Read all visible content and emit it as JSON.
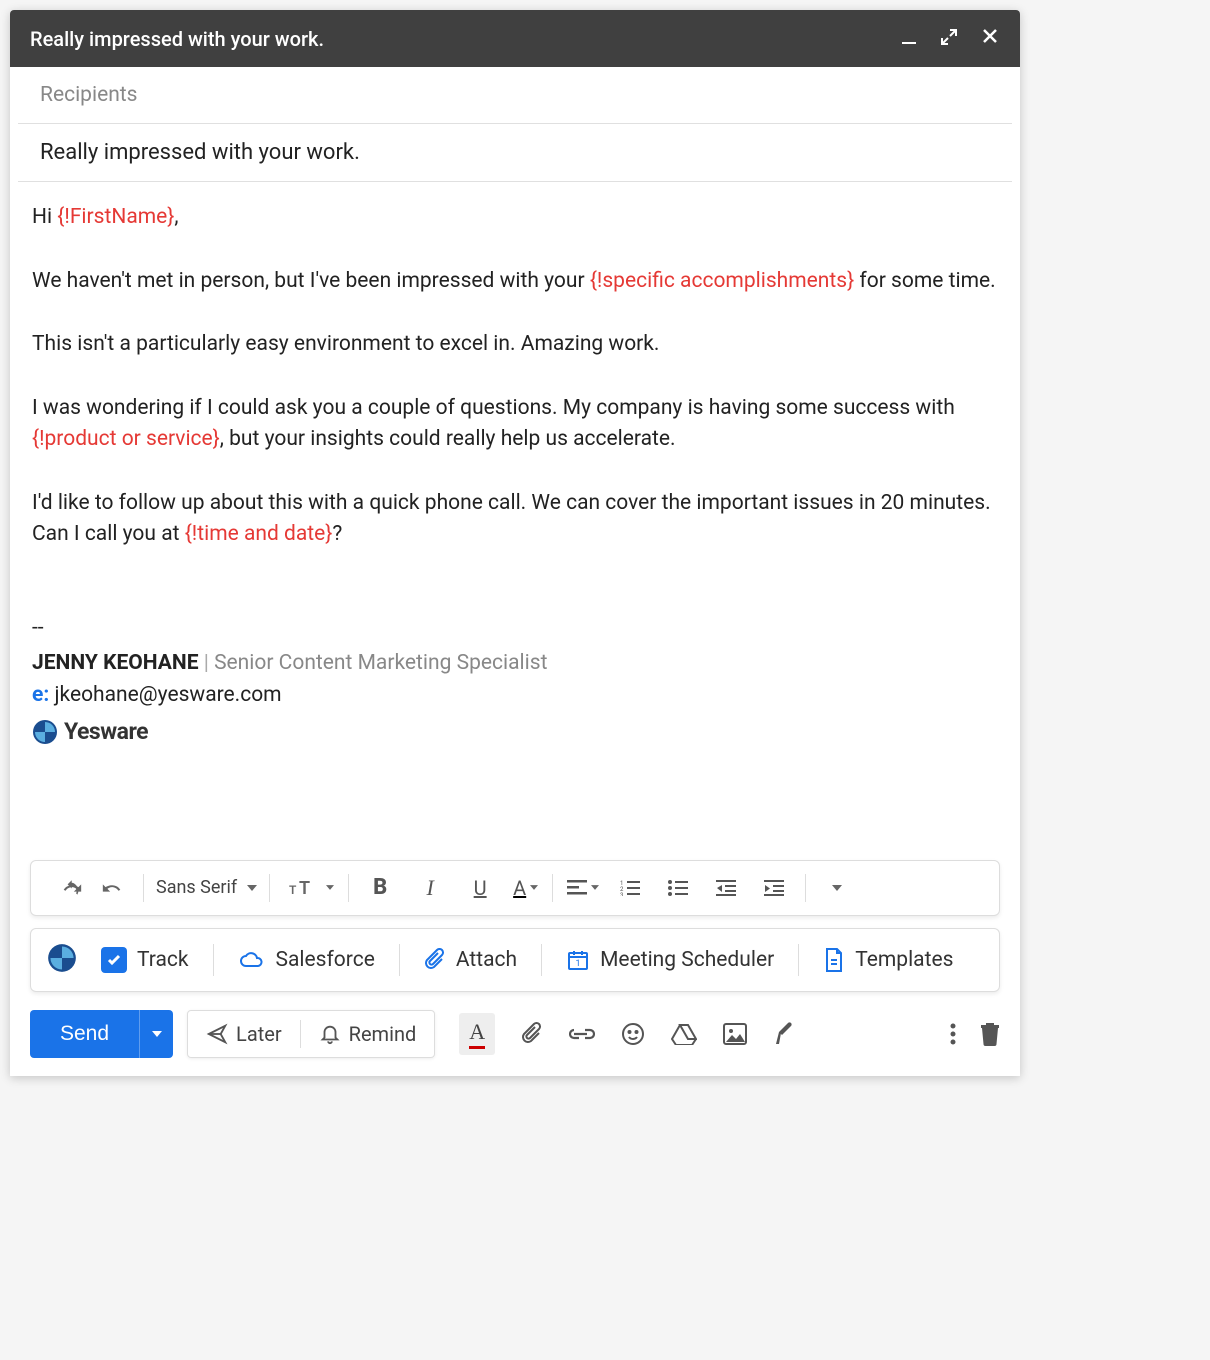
{
  "window": {
    "title": "Really impressed with your work."
  },
  "fields": {
    "recipients_placeholder": "Recipients",
    "subject": "Really impressed with your work."
  },
  "body": {
    "greeting_prefix": "Hi ",
    "merge_firstname": "{!FirstName}",
    "greeting_suffix": ",",
    "p1_a": "We haven't met in person, but I've been impressed with your ",
    "merge_accomplishments": "{!specific accomplishments}",
    "p1_b": " for some time.",
    "p2": "This isn't a particularly easy environment to excel in. Amazing work.",
    "p3_a": "I was wondering if I could ask you a couple of questions. My company is having some success with ",
    "merge_product": "{!product or service}",
    "p3_b": ", but your insights could really help us accelerate.",
    "p4_a": "I'd like to follow up about this with a quick phone call. We can cover the important issues in 20 minutes. Can I call you at ",
    "merge_time": "{!time and date}",
    "p4_b": "?"
  },
  "signature": {
    "divider": "--",
    "name": "JENNY KEOHANE",
    "separator": " | ",
    "title": "Senior Content Marketing Specialist",
    "email_label": "e:",
    "email": "jkeohane@yesware.com",
    "company": "Yesware"
  },
  "format_toolbar": {
    "font": "Sans Serif"
  },
  "yesware_bar": {
    "track": "Track",
    "salesforce": "Salesforce",
    "attach": "Attach",
    "meeting": "Meeting Scheduler",
    "templates": "Templates"
  },
  "bottom": {
    "send": "Send",
    "later": "Later",
    "remind": "Remind"
  },
  "colors": {
    "accent": "#1a73e8",
    "merge": "#e53935"
  }
}
